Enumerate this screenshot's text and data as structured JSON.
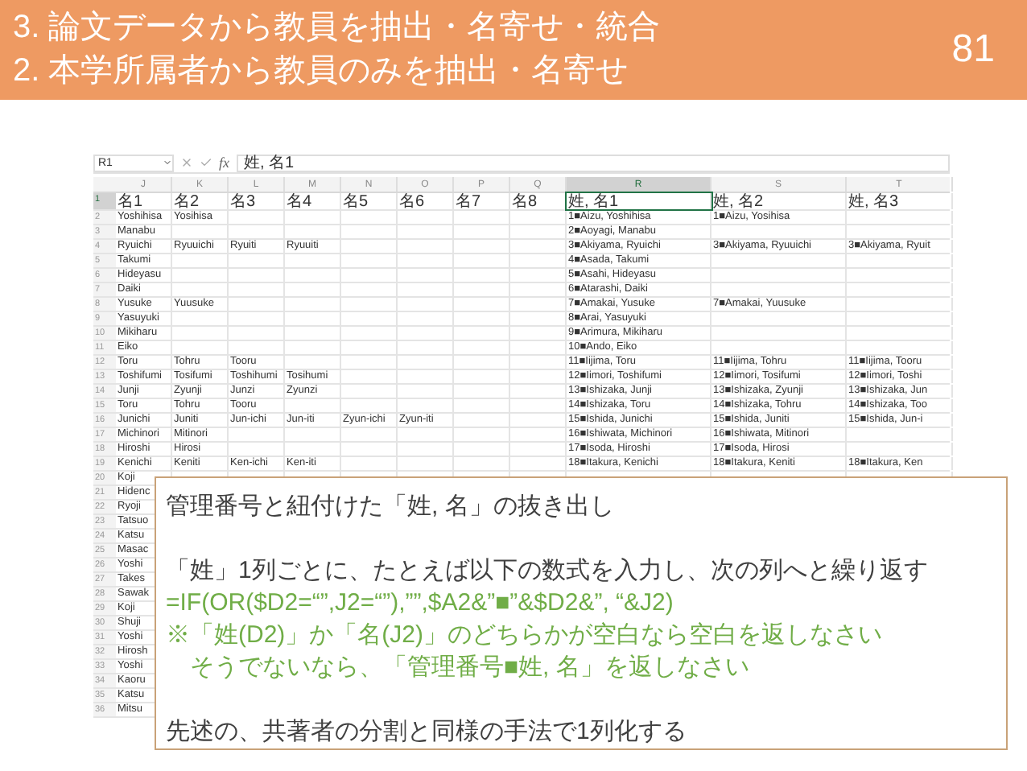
{
  "header": {
    "lines": [
      "3. 論文データから教員を抽出・名寄せ・統合",
      "2. 本学所属者から教員のみを抽出・名寄せ"
    ],
    "page_number": "81"
  },
  "spreadsheet": {
    "name_box": "R1",
    "function_label": "fx",
    "formula": "姓, 名1",
    "columns": [
      {
        "letter": "J",
        "selected": false
      },
      {
        "letter": "K",
        "selected": false
      },
      {
        "letter": "L",
        "selected": false
      },
      {
        "letter": "M",
        "selected": false
      },
      {
        "letter": "N",
        "selected": false
      },
      {
        "letter": "O",
        "selected": false
      },
      {
        "letter": "P",
        "selected": false
      },
      {
        "letter": "Q",
        "selected": false
      },
      {
        "letter": "R",
        "selected": true
      },
      {
        "letter": "S",
        "selected": false
      },
      {
        "letter": "T",
        "selected": false
      }
    ],
    "rows": [
      {
        "number": "1",
        "selected": true,
        "cells": {
          "J": "名1",
          "K": "名2",
          "L": "名3",
          "M": "名4",
          "N": "名5",
          "O": "名6",
          "P": "名7",
          "Q": "名8",
          "R": "姓, 名1",
          "S": "姓, 名2",
          "T": "姓, 名3"
        }
      },
      {
        "number": "2",
        "selected": false,
        "cells": {
          "J": "Yoshihisa",
          "K": "Yosihisa",
          "R": "1■Aizu, Yoshihisa",
          "S": "1■Aizu, Yosihisa"
        }
      },
      {
        "number": "3",
        "selected": false,
        "cells": {
          "J": "Manabu",
          "R": "2■Aoyagi, Manabu"
        }
      },
      {
        "number": "4",
        "selected": false,
        "cells": {
          "J": "Ryuichi",
          "K": "Ryuuichi",
          "L": "Ryuiti",
          "M": "Ryuuiti",
          "R": "3■Akiyama, Ryuichi",
          "S": "3■Akiyama, Ryuuichi",
          "T": "3■Akiyama, Ryuit"
        }
      },
      {
        "number": "5",
        "selected": false,
        "cells": {
          "J": "Takumi",
          "R": "4■Asada, Takumi"
        }
      },
      {
        "number": "6",
        "selected": false,
        "cells": {
          "J": "Hideyasu",
          "R": "5■Asahi, Hideyasu"
        }
      },
      {
        "number": "7",
        "selected": false,
        "cells": {
          "J": "Daiki",
          "R": "6■Atarashi, Daiki"
        }
      },
      {
        "number": "8",
        "selected": false,
        "cells": {
          "J": "Yusuke",
          "K": "Yuusuke",
          "R": "7■Amakai, Yusuke",
          "S": "7■Amakai, Yuusuke"
        }
      },
      {
        "number": "9",
        "selected": false,
        "cells": {
          "J": "Yasuyuki",
          "R": "8■Arai, Yasuyuki"
        }
      },
      {
        "number": "10",
        "selected": false,
        "cells": {
          "J": "Mikiharu",
          "R": "9■Arimura, Mikiharu"
        }
      },
      {
        "number": "11",
        "selected": false,
        "cells": {
          "J": "Eiko",
          "R": "10■Ando, Eiko"
        }
      },
      {
        "number": "12",
        "selected": false,
        "cells": {
          "J": "Toru",
          "K": "Tohru",
          "L": "Tooru",
          "R": "11■Iijima, Toru",
          "S": "11■Iijima, Tohru",
          "T": "11■Iijima, Tooru"
        }
      },
      {
        "number": "13",
        "selected": false,
        "cells": {
          "J": "Toshifumi",
          "K": "Tosifumi",
          "L": "Toshihumi",
          "M": "Tosihumi",
          "R": "12■Iimori, Toshifumi",
          "S": "12■Iimori, Tosifumi",
          "T": "12■Iimori, Toshi"
        }
      },
      {
        "number": "14",
        "selected": false,
        "cells": {
          "J": "Junji",
          "K": "Zyunji",
          "L": "Junzi",
          "M": "Zyunzi",
          "R": "13■Ishizaka, Junji",
          "S": "13■Ishizaka, Zyunji",
          "T": "13■Ishizaka, Jun"
        }
      },
      {
        "number": "15",
        "selected": false,
        "cells": {
          "J": "Toru",
          "K": "Tohru",
          "L": "Tooru",
          "R": "14■Ishizaka, Toru",
          "S": "14■Ishizaka, Tohru",
          "T": "14■Ishizaka, Too"
        }
      },
      {
        "number": "16",
        "selected": false,
        "cells": {
          "J": "Junichi",
          "K": "Juniti",
          "L": "Jun-ichi",
          "M": "Jun-iti",
          "N": "Zyun-ichi",
          "O": "Zyun-iti",
          "R": "15■Ishida, Junichi",
          "S": "15■Ishida, Juniti",
          "T": "15■Ishida, Jun-i"
        }
      },
      {
        "number": "17",
        "selected": false,
        "cells": {
          "J": "Michinori",
          "K": "Mitinori",
          "R": "16■Ishiwata, Michinori",
          "S": "16■Ishiwata, Mitinori"
        }
      },
      {
        "number": "18",
        "selected": false,
        "cells": {
          "J": "Hiroshi",
          "K": "Hirosi",
          "R": "17■Isoda, Hiroshi",
          "S": "17■Isoda, Hirosi"
        }
      },
      {
        "number": "19",
        "selected": false,
        "cells": {
          "J": "Kenichi",
          "K": "Keniti",
          "L": "Ken-ichi",
          "M": "Ken-iti",
          "R": "18■Itakura, Kenichi",
          "S": "18■Itakura, Keniti",
          "T": "18■Itakura, Ken"
        }
      },
      {
        "number": "20",
        "selected": false,
        "cells": {
          "J": "Koji"
        }
      },
      {
        "number": "21",
        "selected": false,
        "cells": {
          "J": "Hidenc"
        }
      },
      {
        "number": "22",
        "selected": false,
        "cells": {
          "J": "Ryoji"
        }
      },
      {
        "number": "23",
        "selected": false,
        "cells": {
          "J": "Tatsuo"
        }
      },
      {
        "number": "24",
        "selected": false,
        "cells": {
          "J": "Katsu"
        }
      },
      {
        "number": "25",
        "selected": false,
        "cells": {
          "J": "Masac"
        }
      },
      {
        "number": "26",
        "selected": false,
        "cells": {
          "J": "Yoshi"
        }
      },
      {
        "number": "27",
        "selected": false,
        "cells": {
          "J": "Takes"
        }
      },
      {
        "number": "28",
        "selected": false,
        "cells": {
          "J": "Sawak"
        }
      },
      {
        "number": "29",
        "selected": false,
        "cells": {
          "J": "Koji"
        }
      },
      {
        "number": "30",
        "selected": false,
        "cells": {
          "J": "Shuji"
        }
      },
      {
        "number": "31",
        "selected": false,
        "cells": {
          "J": "Yoshi"
        }
      },
      {
        "number": "32",
        "selected": false,
        "cells": {
          "J": "Hirosh"
        }
      },
      {
        "number": "33",
        "selected": false,
        "cells": {
          "J": "Yoshi"
        }
      },
      {
        "number": "34",
        "selected": false,
        "cells": {
          "J": "Kaoru"
        }
      },
      {
        "number": "35",
        "selected": false,
        "cells": {
          "J": "Katsu"
        }
      },
      {
        "number": "36",
        "selected": false,
        "cells": {
          "J": "Mitsu"
        }
      }
    ]
  },
  "callout": {
    "lines": [
      {
        "kind": "normal",
        "text": "管理番号と紐付けた「姓, 名」の抜き出し"
      },
      {
        "kind": "gap"
      },
      {
        "kind": "normal",
        "text": "「姓」1列ごとに、たとえば以下の数式を入力し、次の列へと繰り返す"
      },
      {
        "kind": "formula",
        "text": "=IF(OR($D2=“”,J2=“”),””,$A2&”■”&$D2&”, “&J2)"
      },
      {
        "kind": "formula",
        "text": "※「姓(D2)」か「名(J2)」のどちらかが空白なら空白を返しなさい"
      },
      {
        "kind": "formula",
        "text": "　そうでないなら、「管理番号■姓, 名」を返しなさい"
      },
      {
        "kind": "gap"
      },
      {
        "kind": "normal",
        "text": "先述の、共著者の分割と同様の手法で1列化する"
      }
    ]
  }
}
